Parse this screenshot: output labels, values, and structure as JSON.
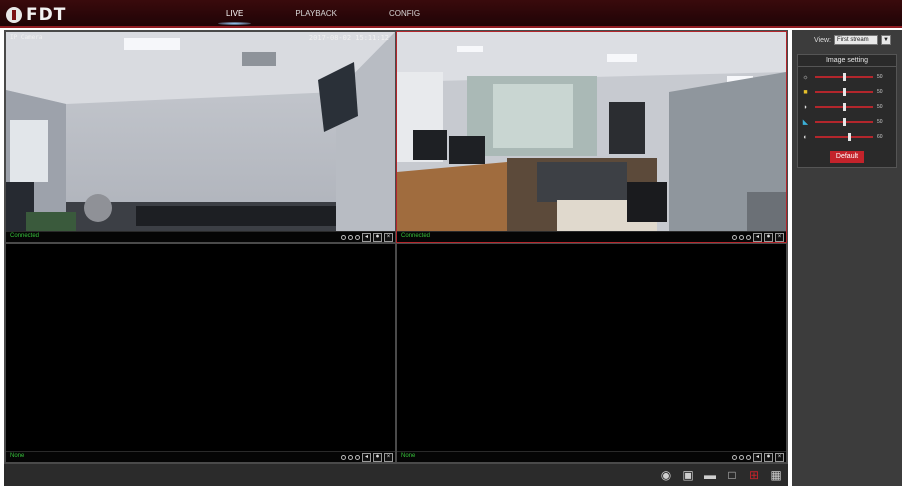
{
  "app": {
    "logo_text": "FDT"
  },
  "nav": {
    "items": [
      "LIVE",
      "PLAYBACK",
      "CONFIG"
    ],
    "active": "LIVE"
  },
  "cameras": [
    {
      "osd_name": "IP Camera",
      "osd_time": "2017-08-02 15:11:12",
      "status": "Connected"
    },
    {
      "status": "Connected"
    },
    {
      "status": "None"
    },
    {
      "status": "None"
    }
  ],
  "panel": {
    "view_label": "View:",
    "stream": "First stream",
    "image_setting_title": "Image setting",
    "sliders": [
      {
        "icon": "brightness-icon",
        "value": 50
      },
      {
        "icon": "contrast-icon",
        "value": 50
      },
      {
        "icon": "saturation-icon",
        "value": 50
      },
      {
        "icon": "sharpness-icon",
        "value": 50
      },
      {
        "icon": "hue-icon",
        "value": 60
      }
    ],
    "slider_values": [
      "50",
      "50",
      "50",
      "50",
      "60"
    ],
    "default_label": "Default"
  },
  "toolbar": {
    "icons": [
      "snapshot-icon",
      "record-icon",
      "fullscreen-icon",
      "layout-1-icon",
      "layout-4-icon",
      "layout-9-icon"
    ]
  },
  "colors": {
    "accent": "#b3262c",
    "status_green": "#36c23a",
    "topbar": "#2a0608"
  }
}
